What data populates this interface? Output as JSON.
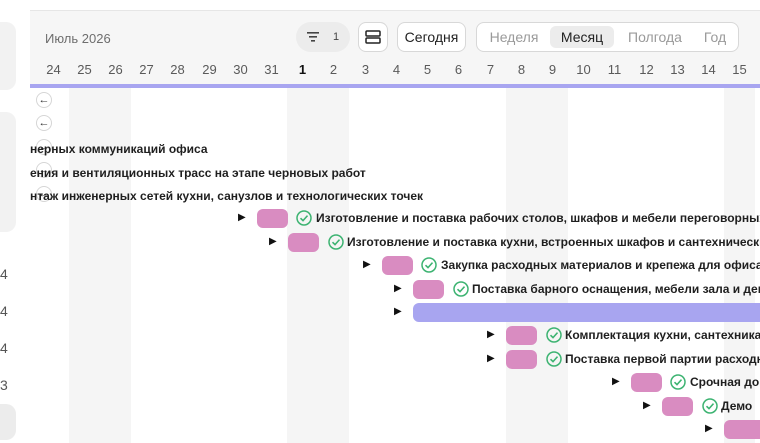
{
  "header": {
    "month": "Июль 2026",
    "filter_count": "1",
    "today_label": "Сегодня",
    "views": [
      "Неделя",
      "Месяц",
      "Полгода",
      "Год"
    ],
    "active_view": "Месяц"
  },
  "days": [
    "24",
    "25",
    "26",
    "27",
    "28",
    "29",
    "30",
    "31",
    "1",
    "2",
    "3",
    "4",
    "5",
    "6",
    "7",
    "8",
    "9",
    "10",
    "11",
    "12",
    "13",
    "14",
    "15"
  ],
  "left_numbers": [
    "4",
    "4",
    "4",
    "3"
  ],
  "truncated_labels": [
    "нерных коммуникаций офиса",
    "ения и вентиляционных трасс на этапе черновых работ",
    "нтаж инженерных сетей кухни, санузлов и технологических точек"
  ],
  "tasks": [
    {
      "label": "Изготовление и поставка рабочих столов, шкафов и мебели переговорных"
    },
    {
      "label": "Изготовление и поставка кухни, встроенных шкафов и сантехнических мо"
    },
    {
      "label": "Закупка расходных материалов и крепежа для офиса"
    },
    {
      "label": "Поставка барного оснащения, мебели зала и декор"
    },
    {
      "label": ""
    },
    {
      "label": "Комплектация кухни, сантехника"
    },
    {
      "label": "Поставка первой партии расходн"
    },
    {
      "label": "Срочная до"
    },
    {
      "label": "Демо"
    },
    {
      "label": ""
    }
  ],
  "colors": {
    "task_bar": "#d98cc1",
    "summary_bar": "#a8a5f0",
    "check": "#3cb371"
  }
}
